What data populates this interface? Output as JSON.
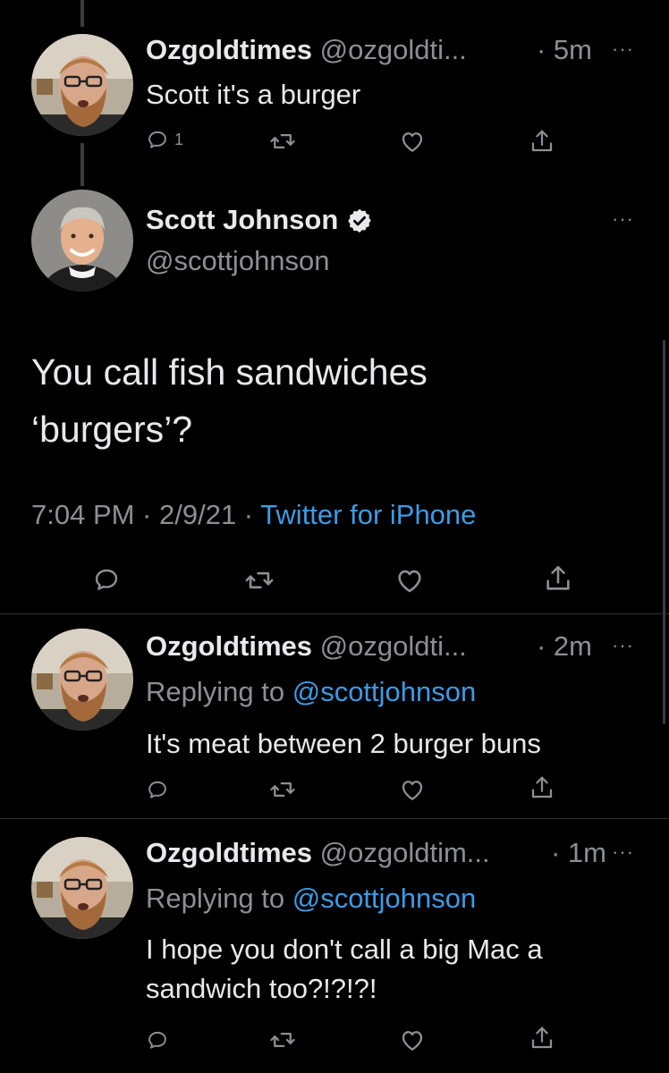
{
  "colors": {
    "background": "#000000",
    "text": "#e7e9ea",
    "secondary": "#8b9096",
    "link": "#3c9be6",
    "divider": "#2f3336"
  },
  "tweet1": {
    "name": "Ozgoldtimes",
    "handle": "@ozgoldti...",
    "time": "· 5m",
    "text": "Scott it's a burger",
    "reply_count": "1"
  },
  "main": {
    "name": "Scott Johnson",
    "handle": "@scottjohnson",
    "text_line1": "You call fish sandwiches",
    "text_line2": "‘burgers’?",
    "time": "7:04 PM · 2/9/21 · ",
    "source": "Twitter for iPhone"
  },
  "reply1": {
    "name": "Ozgoldtimes",
    "handle": "@ozgoldti...",
    "time": "· 2m",
    "replying_prefix": "Replying to ",
    "replying_to": "@scottjohnson",
    "text": "It's meat between 2 burger buns"
  },
  "reply2": {
    "name": "Ozgoldtimes",
    "handle": "@ozgoldtim...",
    "time": "· 1m",
    "replying_prefix": "Replying to ",
    "replying_to": "@scottjohnson",
    "text_line1": "I hope you don't call a big Mac a",
    "text_line2": "sandwich too?!?!?!"
  },
  "icons": {
    "more": "more-icon",
    "reply": "reply-icon",
    "retweet": "retweet-icon",
    "like": "like-icon",
    "share": "share-icon",
    "verified": "verified-badge-icon"
  }
}
